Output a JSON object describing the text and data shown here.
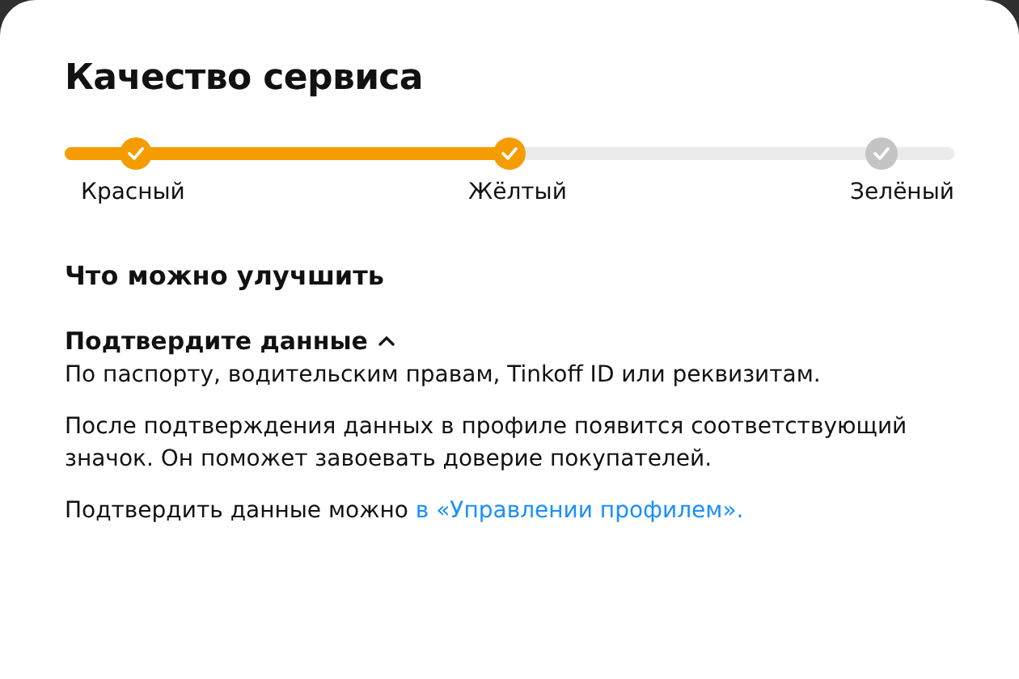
{
  "title": "Качество сервиса",
  "progress": {
    "level": 0.5,
    "steps": [
      {
        "label": "Красный",
        "done": true
      },
      {
        "label": "Жёлтый",
        "done": true
      },
      {
        "label": "Зелёный",
        "done": false
      }
    ]
  },
  "section_title": "Что можно улучшить",
  "item": {
    "title": "Подтвердите данные",
    "expanded": true,
    "subtitle": "По паспорту, водительским правам, Tinkoff ID или реквизитам.",
    "paragraphs": [
      {
        "text": "После подтверждения данных в профиле появится соответствующий значок. Он поможет завоевать доверие покупателей."
      },
      {
        "text": "Подтвердить данные можно ",
        "link": "в «Управлении профилем»."
      }
    ]
  }
}
